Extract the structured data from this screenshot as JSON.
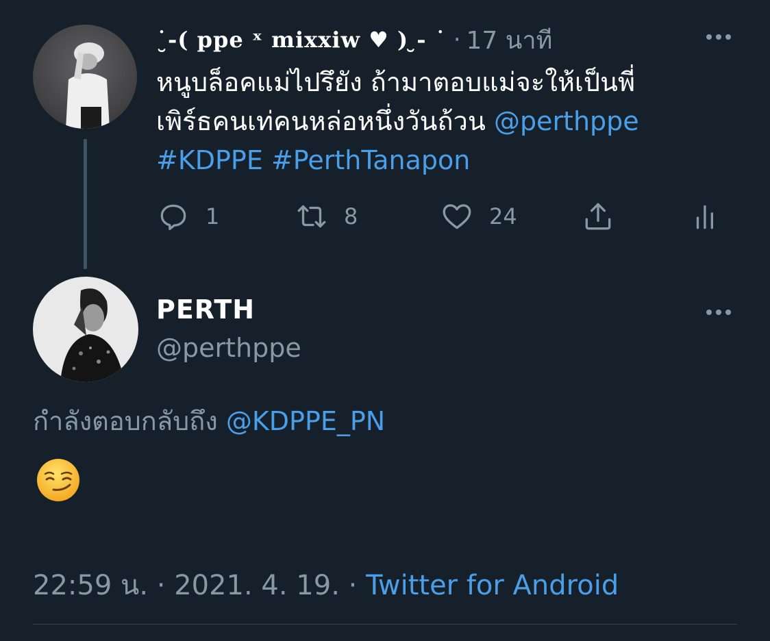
{
  "tweet1": {
    "display_name": "˙̮-( ppe ˣ mixxiw ♥ ) ̮- ˙",
    "separator": "·",
    "time_ago": "17 นาที",
    "text_line1": "หนูบล็อคแม่ไปรึยัง ถ้ามาตอบแม่จะให้เป็นพี่",
    "text_line2": "เพิร์ธคนเท่คนหล่อหนึ่งวันถ้วน ",
    "mention": "@perthppe",
    "hashtag1": "#KDPPE",
    "hashtag2": "#PerthTanapon",
    "replies": "1",
    "retweets": "8",
    "likes": "24"
  },
  "tweet2": {
    "display_name": "PERTH",
    "handle": "@perthppe",
    "replying_prefix": "กำลังตอบกลับถึง ",
    "replying_to": "@KDPPE_PN",
    "emoji": "smirking-face",
    "time": "22:59 น. · 2021. 4. 19. · ",
    "source": "Twitter for Android"
  },
  "colors": {
    "background": "#15202b",
    "secondary_text": "#8899a6",
    "link": "#4a9fe8",
    "thread_line": "#3d5466"
  }
}
